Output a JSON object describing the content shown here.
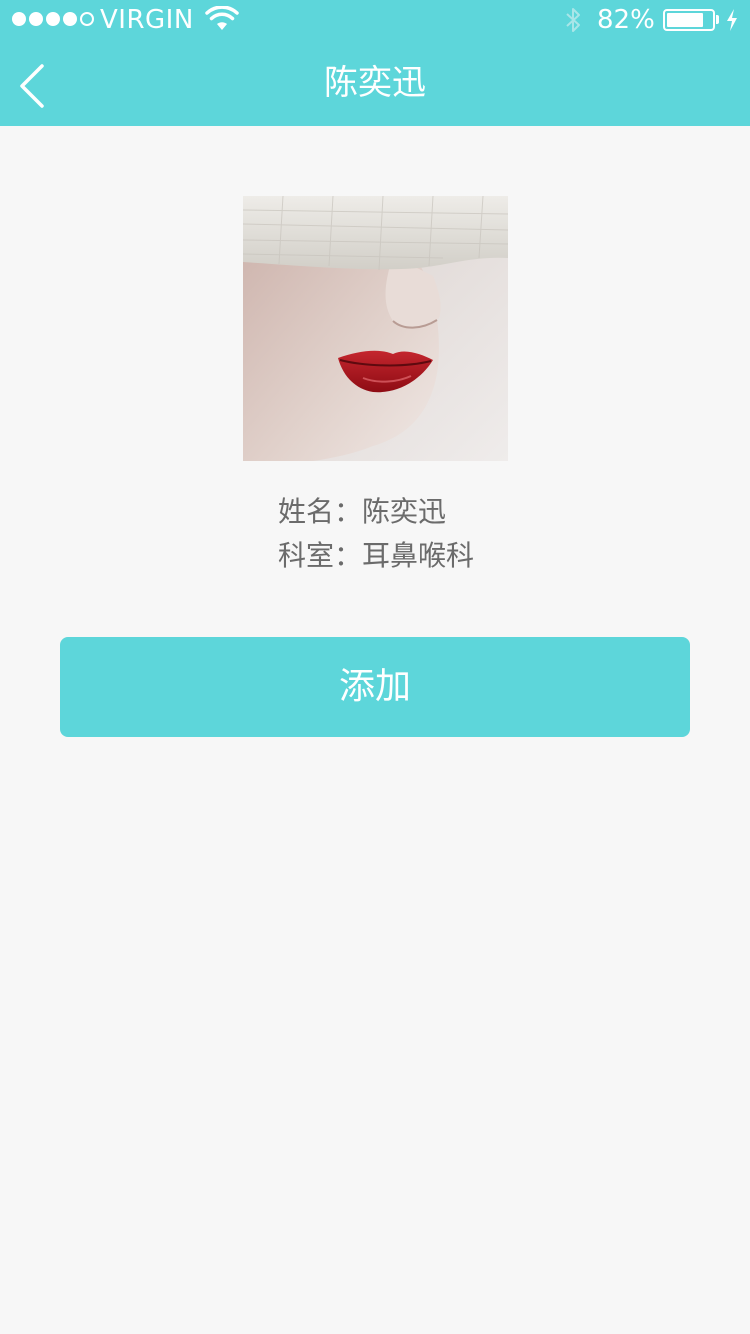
{
  "status_bar": {
    "carrier": "VIRGIN",
    "signal_bars": 4,
    "signal_total": 5,
    "battery_percent_label": "82%",
    "battery_level": 0.82,
    "icons": [
      "wifi-icon",
      "bluetooth-icon",
      "battery-icon",
      "charging-icon"
    ]
  },
  "nav": {
    "title": "陈奕迅",
    "back_icon": "chevron-left-icon"
  },
  "profile": {
    "name_label": "姓名：",
    "name_value": "陈奕迅",
    "dept_label": "科室：",
    "dept_value": "耳鼻喉科"
  },
  "actions": {
    "add_label": "添加"
  },
  "colors": {
    "accent": "#5dd6da",
    "background": "#f7f7f7",
    "text": "#6b6b6b",
    "lip_red": "#b3151f"
  }
}
